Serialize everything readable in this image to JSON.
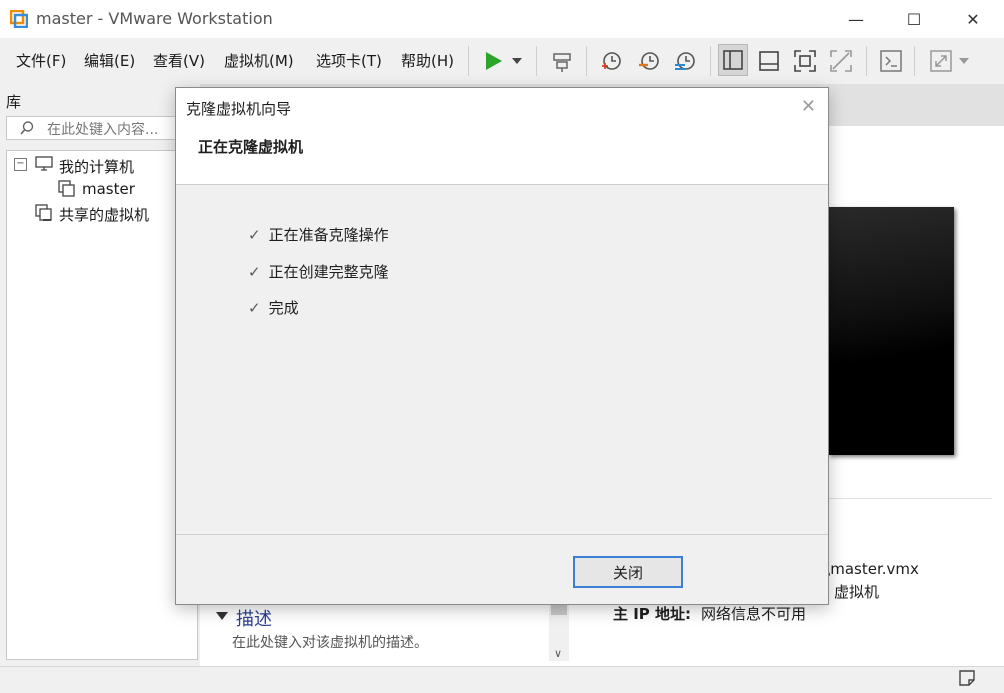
{
  "window": {
    "title": "master - VMware Workstation"
  },
  "menubar": {
    "items": [
      "文件(F)",
      "编辑(E)",
      "查看(V)",
      "虚拟机(M)",
      "选项卡(T)",
      "帮助(H)"
    ]
  },
  "library": {
    "title": "库",
    "search_placeholder": "在此处键入内容...",
    "tree": {
      "my_computer": "我的计算机",
      "vm": "master",
      "shared": "共享的虚拟机"
    }
  },
  "main": {
    "description_header": "描述",
    "description_placeholder": "在此处键入对该虚拟机的描述。",
    "vmx_path_fragment": "r\\master.vmx",
    "vm_type_fragment": "虚拟机",
    "ip_label": "主 IP 地址:",
    "ip_value": "网络信息不可用"
  },
  "dialog": {
    "title": "克隆虚拟机向导",
    "subtitle": "正在克隆虚拟机",
    "steps": [
      "正在准备克隆操作",
      "正在创建完整克隆",
      "完成"
    ],
    "close_button": "关闭"
  },
  "colors": {
    "accent": "#3b7fd4",
    "play": "#2aa52a"
  }
}
